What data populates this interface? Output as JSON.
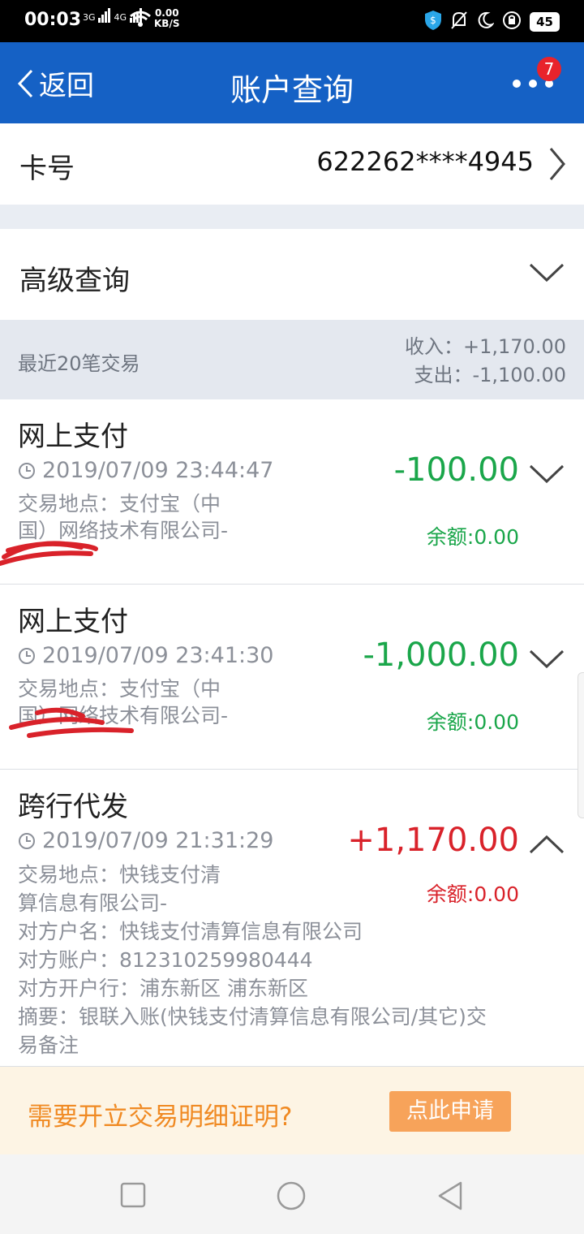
{
  "status_bar": {
    "time": "00:03",
    "network_1": "3G",
    "network_2": "4G",
    "speed_value": "0.00",
    "speed_unit": "KB/S",
    "battery": "45"
  },
  "navbar": {
    "back_label": "返回",
    "title": "账户查询",
    "badge_count": "7"
  },
  "card": {
    "label": "卡号",
    "number": "622262****4945"
  },
  "advanced_query": {
    "label": "高级查询"
  },
  "summary": {
    "recent_label": "最近20笔交易",
    "income": "收入：+1,170.00",
    "expense": "支出：-1,100.00"
  },
  "transactions": [
    {
      "type": "网上支付",
      "time": "2019/07/09 23:44:47",
      "amount": "-100.00",
      "balance": "余额:0.00",
      "location_line1": "交易地点：支付宝（中",
      "location_line2": "国）网络技术有限公司-"
    },
    {
      "type": "网上支付",
      "time": "2019/07/09 23:41:30",
      "amount": "-1,000.00",
      "balance": "余额:0.00",
      "location_line1": "交易地点：支付宝（中",
      "location_line2": "国）网络技术有限公司-"
    },
    {
      "type": "跨行代发",
      "time": "2019/07/09 21:31:29",
      "amount": "+1,170.00",
      "balance": "余额:0.00",
      "location_line1": "交易地点：快钱支付清",
      "location_line2": "算信息有限公司-",
      "counterparty_name": "对方户名：快钱支付清算信息有限公司",
      "counterparty_account": "对方账户：812310259980444",
      "counterparty_bank": "对方开户行：浦东新区 浦东新区",
      "memo_line1": "摘要：银联入账(快钱支付清算信息有限公司/其它)交",
      "memo_line2": "易备注"
    }
  ],
  "banner": {
    "question": "需要开立交易明细证明?",
    "button": "点此申请"
  },
  "colors": {
    "nav_blue": "#1561c5",
    "debit_green": "#1aa64a",
    "credit_red": "#d9222a",
    "banner_orange": "#f08a23"
  }
}
